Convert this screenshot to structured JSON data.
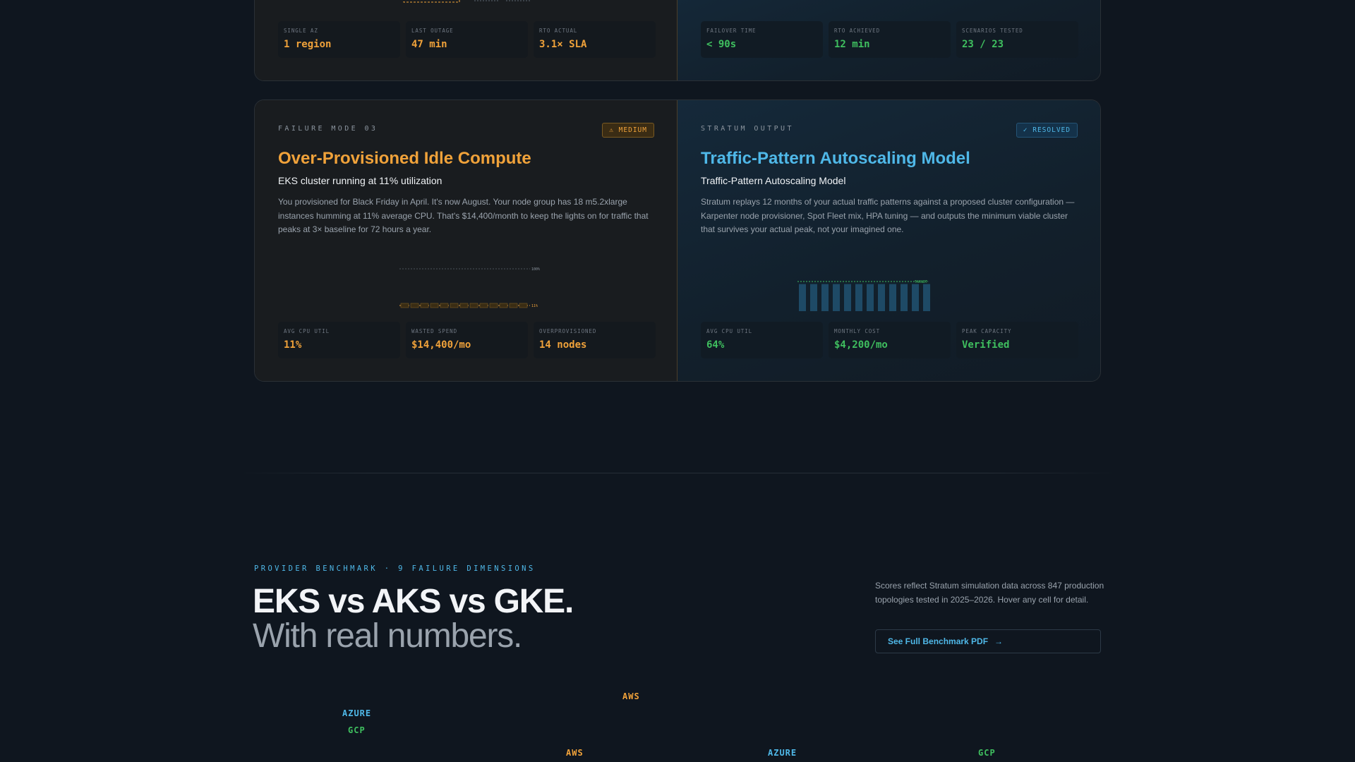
{
  "colors": {
    "warn": "#f0a23a",
    "info": "#4fb8e8",
    "success": "#3fbf5f",
    "background": "#0f161f"
  },
  "row_top": {
    "failure": {
      "stats": [
        {
          "label": "SINGLE AZ",
          "value": "1 region"
        },
        {
          "label": "LAST OUTAGE",
          "value": "47 min"
        },
        {
          "label": "RTO ACTUAL",
          "value": "3.1× SLA"
        }
      ]
    },
    "solution": {
      "stats": [
        {
          "label": "FAILOVER TIME",
          "value": "< 90s"
        },
        {
          "label": "RTO ACHIEVED",
          "value": "12 min"
        },
        {
          "label": "SCENARIOS TESTED",
          "value": "23 / 23"
        }
      ]
    }
  },
  "row_mid": {
    "failure": {
      "eyebrow": "FAILURE MODE 03",
      "badge": "⚠ MEDIUM",
      "title": "Over-Provisioned Idle Compute",
      "subtitle": "EKS cluster running at 11% utilization",
      "description": "You provisioned for Black Friday in April. It's now August. Your node group has 18 m5.2xlarge instances humming at 11% average CPU. That's $14,400/month to keep the lights on for traffic that peaks at 3× baseline for 72 hours a year.",
      "viz": {
        "capacity_label": "100%",
        "util_label": "11%",
        "bar_count": 13,
        "bar_utilization": 0.11
      },
      "stats": [
        {
          "label": "AVG CPU UTIL",
          "value": "11%"
        },
        {
          "label": "WASTED SPEND",
          "value": "$14,400/mo"
        },
        {
          "label": "OVERPROVISIONED",
          "value": "14 nodes"
        }
      ]
    },
    "solution": {
      "eyebrow": "STRATUM OUTPUT",
      "badge": "✓ RESOLVED",
      "title": "Traffic-Pattern Autoscaling Model",
      "subtitle": "Traffic-Pattern Autoscaling Model",
      "description": "Stratum replays 12 months of your actual traffic patterns against a proposed cluster configuration — Karpenter node provisioner, Spot Fleet mix, HPA tuning — and outputs the minimum viable cluster that survives your actual peak, not your imagined one.",
      "viz": {
        "target_label": "TARGET",
        "bar_count": 12,
        "bar_utilization": 0.64
      },
      "stats": [
        {
          "label": "AVG CPU UTIL",
          "value": "64%"
        },
        {
          "label": "MONTHLY COST",
          "value": "$4,200/mo"
        },
        {
          "label": "PEAK CAPACITY",
          "value": "Verified"
        }
      ]
    }
  },
  "benchmark": {
    "eyebrow": "PROVIDER BENCHMARK · 9 FAILURE DIMENSIONS",
    "heading_line1": "EKS vs AKS vs GKE.",
    "heading_line2": "With real numbers.",
    "note": "Scores reflect Stratum simulation data across 847 production topologies tested in 2025–2026. Hover any cell for detail.",
    "button_label": "See Full Benchmark PDF",
    "button_arrow": "→",
    "providers_row1": [
      "AWS",
      "AZURE",
      "GCP"
    ],
    "providers_row2": [
      "AWS",
      "AZURE",
      "GCP"
    ]
  }
}
